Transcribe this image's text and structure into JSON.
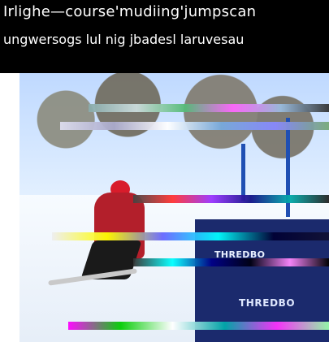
{
  "caption": {
    "line1": "Irlighe—course'mudiing'jumpscan",
    "line2": "ungwersogs lul nig jbadesl laruvesau"
  },
  "photo": {
    "banner_text": "THREDBO",
    "banner_text_large": "THREDBO"
  },
  "colors": {
    "caption_bg": "#000000",
    "caption_text": "#ffffff",
    "pole_blue": "#1f4fb3",
    "banner_navy": "#1b2a6d",
    "jacket_red": "#b31f2b"
  }
}
